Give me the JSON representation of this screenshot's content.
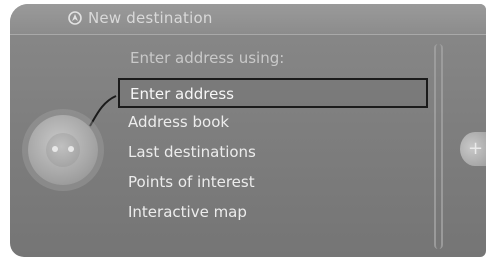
{
  "header": {
    "title": "New destination",
    "icon": "navigation-icon"
  },
  "prompt": "Enter address using:",
  "menu": {
    "selected_index": 0,
    "items": [
      {
        "label": "Enter address"
      },
      {
        "label": "Address book"
      },
      {
        "label": "Last destinations"
      },
      {
        "label": "Points of interest"
      },
      {
        "label": "Interactive map"
      }
    ]
  },
  "right_knob": {
    "symbol": "+"
  },
  "colors": {
    "screen_bg": "#7f7f7f",
    "text": "#ececec",
    "selection_border": "#1b1b1b"
  }
}
